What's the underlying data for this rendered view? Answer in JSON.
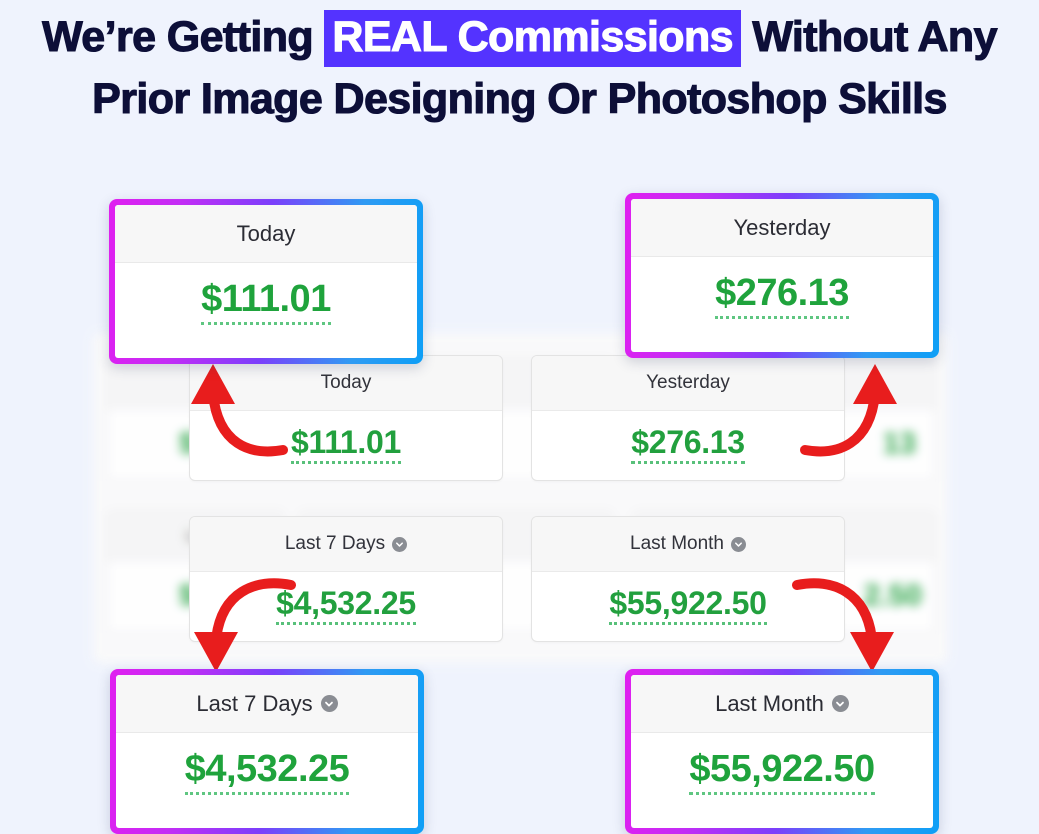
{
  "headline": {
    "part1": "We’re Getting ",
    "highlight": "REAL Commissions",
    "part2": " Without Any",
    "line2": "Prior Image Designing Or Photoshop Skills",
    "highlight_color": "#5433ff",
    "text_color": "#0d0f38"
  },
  "theme": {
    "page_background": "#eff3fd",
    "amount_green": "#22a03e",
    "gradient_start": "#e01ff0",
    "gradient_end": "#0e9ff6",
    "arrow_color": "#e81d1d"
  },
  "callouts": [
    {
      "label": "Today",
      "amount": "$111.01",
      "icon": null
    },
    {
      "label": "Yesterday",
      "amount": "$276.13",
      "icon": null
    },
    {
      "label": "Last 7 Days",
      "amount": "$4,532.25",
      "icon": "chevron-down-circle-icon"
    },
    {
      "label": "Last Month",
      "amount": "$55,922.50",
      "icon": "chevron-down-circle-icon"
    }
  ],
  "dashboard_cards": [
    {
      "label": "Today",
      "amount": "$111.01",
      "icon": null
    },
    {
      "label": "Yesterday",
      "amount": "$276.13",
      "icon": null
    },
    {
      "label": "Last 7 Days",
      "amount": "$4,532.25",
      "icon": "chevron-down-circle-icon"
    },
    {
      "label": "Last Month",
      "amount": "$55,922.50",
      "icon": "chevron-down-circle-icon"
    }
  ],
  "background_cards": [
    {
      "amount": "$1"
    },
    {
      "label": "La",
      "amount": "$4"
    },
    {
      "amount": "13"
    },
    {
      "amount": "2.50"
    }
  ]
}
